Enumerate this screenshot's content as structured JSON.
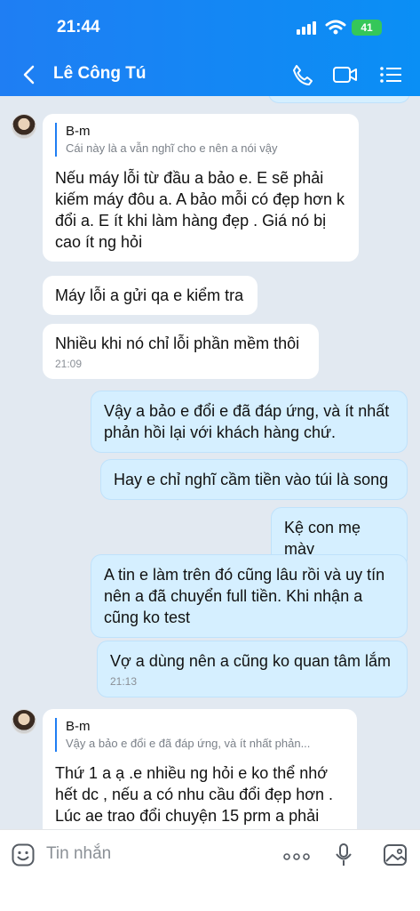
{
  "status_bar": {
    "time": "21:44",
    "battery": "41"
  },
  "header": {
    "contact_name": "Lê Công Tú"
  },
  "messages": [
    {
      "quote_name": "B-m",
      "quote_text": "Cái này là a vẫn nghĩ cho e nên a nói vậy",
      "text": "Nếu máy lỗi từ đầu a bảo e. E sẽ phải kiếm máy đôu a. A bảo mỗi có đẹp hơn k đổi a. E ít khi làm hàng đẹp . Giá nó bị cao ít ng hỏi"
    },
    {
      "text": "Máy lỗi a gửi qa e kiểm tra"
    },
    {
      "text": "Nhiều khi nó chỉ lỗi phần mềm thôi",
      "time": "21:09"
    },
    {
      "text": "Vậy a bảo e đổi e đã đáp ứng, và ít nhất phản hồi lại với khách hàng chứ."
    },
    {
      "text": "Hay e chỉ nghĩ cầm tiền vào túi là song"
    },
    {
      "text": "Kệ con mẹ mày"
    },
    {
      "text": "A tin e làm trên đó cũng lâu rồi và uy tín nên a đã chuyển full tiền. Khi nhận a cũng ko test"
    },
    {
      "text": "Vợ a dùng nên a cũng ko quan tâm lắm",
      "time": "21:13"
    },
    {
      "quote_name": "B-m",
      "quote_text": "Vậy a bảo e đổi e đã đáp ứng, và ít nhất phản...",
      "text": "Thứ 1 a ạ .e nhiều ng hỏi e ko thể nhớ hết dc , nếu a có nhu cầu đổi đẹp hơn . Lúc ae trao đổi chuyện 15 prm a phải"
    }
  ],
  "input": {
    "placeholder": "Tin nhắn"
  }
}
